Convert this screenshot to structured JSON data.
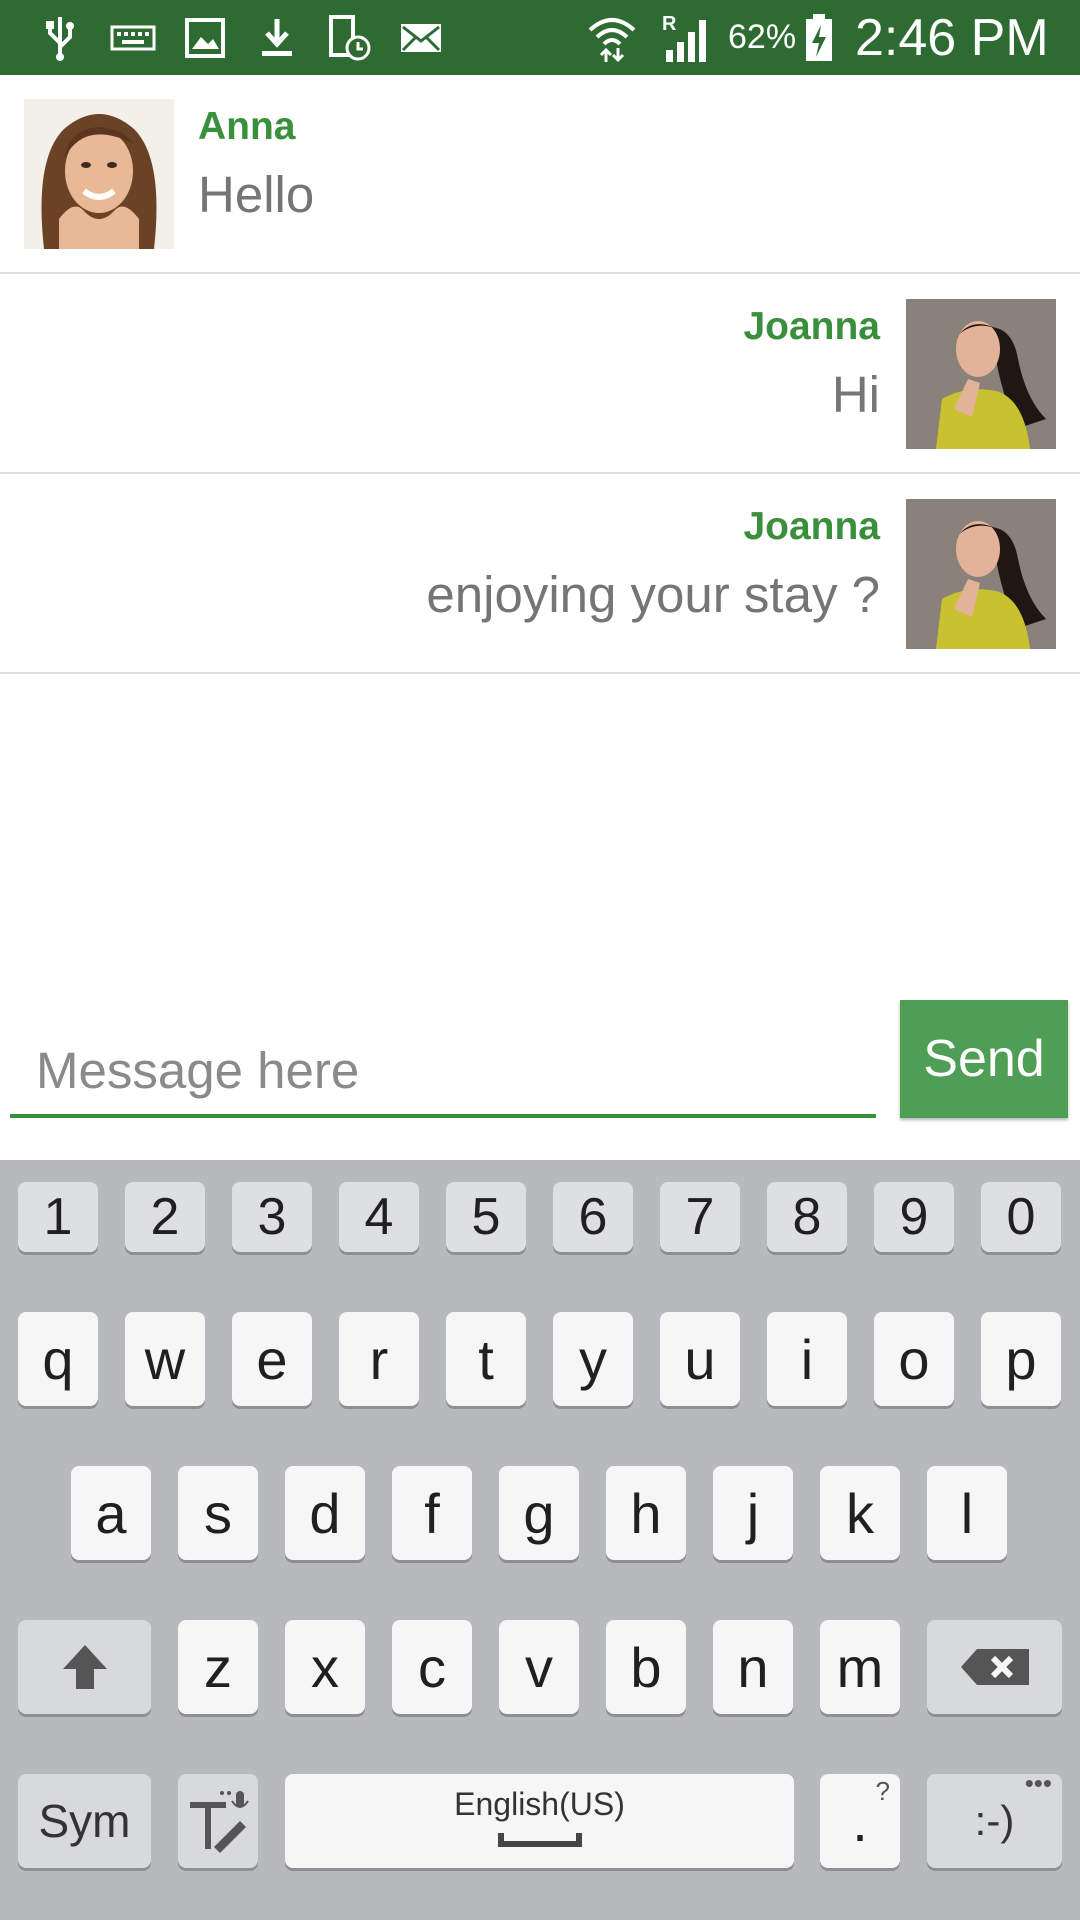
{
  "status_bar": {
    "battery_percent": "62%",
    "time": "2:46 PM",
    "roaming_indicator": "R",
    "icons": [
      "usb-icon",
      "keyboard-icon",
      "image-icon",
      "download-icon",
      "screen-icon",
      "mail-icon",
      "wifi-icon",
      "signal-icon",
      "battery-charging-icon"
    ]
  },
  "messages": [
    {
      "sender": "Anna",
      "text": "Hello",
      "side": "left"
    },
    {
      "sender": "Joanna",
      "text": "Hi",
      "side": "right"
    },
    {
      "sender": "Joanna",
      "text": "enjoying your stay ?",
      "side": "right"
    }
  ],
  "composer": {
    "placeholder": "Message here",
    "value": "",
    "send_label": "Send"
  },
  "keyboard": {
    "number_row": [
      "1",
      "2",
      "3",
      "4",
      "5",
      "6",
      "7",
      "8",
      "9",
      "0"
    ],
    "row1": [
      "q",
      "w",
      "e",
      "r",
      "t",
      "y",
      "u",
      "i",
      "o",
      "p"
    ],
    "row2": [
      "a",
      "s",
      "d",
      "f",
      "g",
      "h",
      "j",
      "k",
      "l"
    ],
    "row3": [
      "z",
      "x",
      "c",
      "v",
      "b",
      "n",
      "m"
    ],
    "sym_label": "Sym",
    "space_label": "English(US)",
    "period_label": ".",
    "period_hint": "?",
    "emoticon_label": ":-)"
  },
  "colors": {
    "status_bar": "#2e6b32",
    "accent": "#3a8f3d",
    "send_button": "#4f9e55",
    "keyboard_bg": "#b8b9bd"
  }
}
